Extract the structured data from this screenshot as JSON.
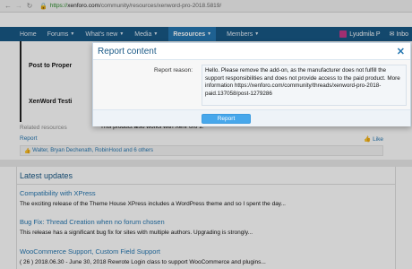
{
  "browser": {
    "url_scheme": "https://",
    "url_host": "xenforo.com",
    "url_path": "/community/resources/xenword-pro-2018.5819/"
  },
  "nav": {
    "tabs": [
      {
        "label": "Home"
      },
      {
        "label": "Forums"
      },
      {
        "label": "What's new"
      },
      {
        "label": "Media"
      },
      {
        "label": "Resources"
      },
      {
        "label": "Members"
      }
    ],
    "user": "Lyudmila P",
    "inbox": "Inbo"
  },
  "resource": {
    "image_line1": "Post to Proper",
    "image_line2": "XenWord Testi",
    "desc_tail": "This product also works with XenForo 1.",
    "related_heading": "Related resources",
    "report_link": "Report",
    "like_link": "Like",
    "likes_text": "Walter, Bryan Dechenath, RobinHood and 6 others"
  },
  "updates": {
    "heading": "Latest updates",
    "items": [
      {
        "title": "Compatibility with XPress",
        "snippet": "The exciting release of the Theme House XPress includes a WordPress theme and so I spent the day..."
      },
      {
        "title": "Bug Fix: Thread Creation when no forum chosen",
        "snippet": "This release has a significant bug fix for sites with multiple authors. Upgrading is strongly..."
      },
      {
        "title": "WooCommerce Support, Custom Field Support",
        "snippet": "( 26 ) 2018.06.30 - June 30, 2018 Rewrote Login class to support WooCommerce and plugins..."
      }
    ]
  },
  "modal": {
    "title": "Report content",
    "reason_label": "Report reason:",
    "reason_value": "Hello. Please remove the add-on, as the manufacturer does not fulfill the support responsibilities and does not provide access to the paid product. More information https://xenforo.com/community/threads/xenword-pro-2018-paid.137058/post-1279286",
    "submit_label": "Report"
  },
  "colors": {
    "nav_bg": "#185886",
    "nav_selected": "#2577b1",
    "link": "#2577b1",
    "button": "#47a7eb"
  }
}
